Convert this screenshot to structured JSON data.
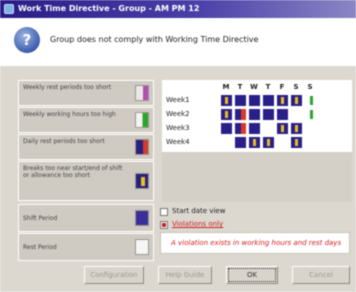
{
  "window": {
    "title": "Work Time Directive - Group - AM PM 12"
  },
  "header": {
    "message": "Group does not comply with Working Time Directive"
  },
  "rules": [
    {
      "label": "Weekly rest periods too short",
      "marker": "lightgray-purple"
    },
    {
      "label": "Weekly working hours too high",
      "marker": "white-green"
    },
    {
      "label": "Daily rest periods too short",
      "marker": "blue-red"
    },
    {
      "label": "Breaks too near start/end of shift or allowance too short",
      "marker": "yellow-bar"
    }
  ],
  "period_rows": [
    {
      "label": "Shift Period",
      "marker": "purple"
    },
    {
      "label": "Rest Period",
      "marker": "white"
    }
  ],
  "calendar": {
    "days": [
      "M",
      "T",
      "W",
      "T",
      "F",
      "S",
      "S"
    ],
    "weeks": [
      {
        "label": "Week1",
        "cells": [
          "yellow",
          "dark",
          "dark",
          "dark",
          "yellow",
          "yellow",
          "green"
        ]
      },
      {
        "label": "Week2",
        "cells": [
          "yellow",
          "dark-red",
          "dark",
          "dark",
          "dark",
          "empty",
          "green"
        ]
      },
      {
        "label": "Week3",
        "cells": [
          "dark",
          "dark-red",
          "dark",
          "empty",
          "yellow",
          "yellow",
          "empty"
        ]
      },
      {
        "label": "Week4",
        "cells": [
          "empty",
          "dark",
          "yellow",
          "yellow",
          "empty",
          "yellow",
          "empty"
        ]
      }
    ]
  },
  "options": {
    "start_date_label": "Start date view",
    "start_date_checked": false,
    "violations_label": "Violations only",
    "violations_checked": true
  },
  "warning": "A violation exists in working hours and rest days",
  "buttons": [
    {
      "label": "Configuration",
      "focused": false
    },
    {
      "label": "Help Guide",
      "focused": false
    },
    {
      "label": "OK",
      "focused": true
    },
    {
      "label": "Cancel",
      "focused": false
    }
  ]
}
